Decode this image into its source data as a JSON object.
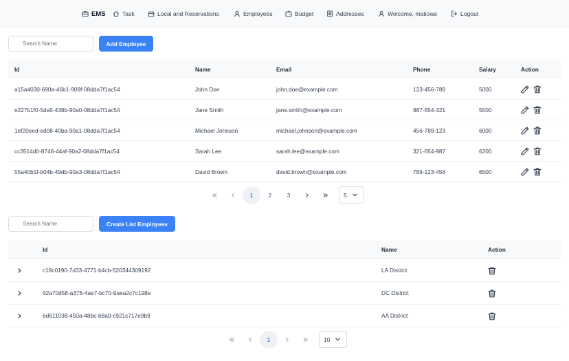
{
  "nav": {
    "brand": "EMS",
    "items": [
      {
        "label": "Task",
        "icon": "home-icon"
      },
      {
        "label": "Local and Reservations",
        "icon": "building-icon"
      },
      {
        "label": "Employees",
        "icon": "user-icon"
      },
      {
        "label": "Budget",
        "icon": "wallet-icon"
      },
      {
        "label": "Addresses",
        "icon": "address-book-icon"
      },
      {
        "label": "Welcome, matiows",
        "icon": "user-icon"
      },
      {
        "label": "Logout",
        "icon": "logout-icon"
      }
    ]
  },
  "employees": {
    "search_placeholder": "Search Name",
    "add_button": "Add Employee",
    "columns": [
      "Id",
      "Name",
      "Email",
      "Phone",
      "Salary",
      "Action"
    ],
    "rows": [
      {
        "id": "a15a4030-690a-46b1-909f-08dda7f1ac54",
        "name": "John Doe",
        "email": "john.doe@example.com",
        "phone": "123-456-789",
        "salary": "5000"
      },
      {
        "id": "e227b1f0-5da5-438b-90a0-08dda7f1ac54",
        "name": "Jane Smith",
        "email": "jane.smith@example.com",
        "phone": "987-654-321",
        "salary": "5500"
      },
      {
        "id": "1ef20eed-ed08-40ba-90a1-08dda7f1ac54",
        "name": "Michael Johnson",
        "email": "michael.johnson@example.com",
        "phone": "456-789-123",
        "salary": "6000"
      },
      {
        "id": "cc3514d0-8746-44af-90a2-08dda7f1ac54",
        "name": "Sarah Lee",
        "email": "sarah.lee@example.com",
        "phone": "321-654-987",
        "salary": "6200"
      },
      {
        "id": "55a40b1f-b04b-49db-90a3-08dda7f1ac54",
        "name": "David Brown",
        "email": "david.brown@example.com",
        "phone": "789-123-456",
        "salary": "6500"
      }
    ],
    "pagination": {
      "pages": [
        "1",
        "2",
        "3"
      ],
      "current": "1",
      "rows_per_page": "5"
    }
  },
  "lists": {
    "search_placeholder": "Search Name",
    "create_button": "Create List Employees",
    "columns": [
      "Id",
      "Name",
      "Action"
    ],
    "rows": [
      {
        "id": "c18c0190-7d33-4771-b4cb-520344309192",
        "name": "LA District"
      },
      {
        "id": "92a70d58-a376-4ae7-bc70-9aea2c7c198e",
        "name": "DC District"
      },
      {
        "id": "6d611038-450a-48bc-b8a0-c921c717e9b9",
        "name": "AA District"
      }
    ],
    "pagination": {
      "pages": [
        "1"
      ],
      "current": "1",
      "rows_per_page": "10"
    }
  },
  "colors": {
    "primary": "#3b82f6",
    "header_bg": "#f8f9fa",
    "active_page": "#1d4ed8"
  }
}
